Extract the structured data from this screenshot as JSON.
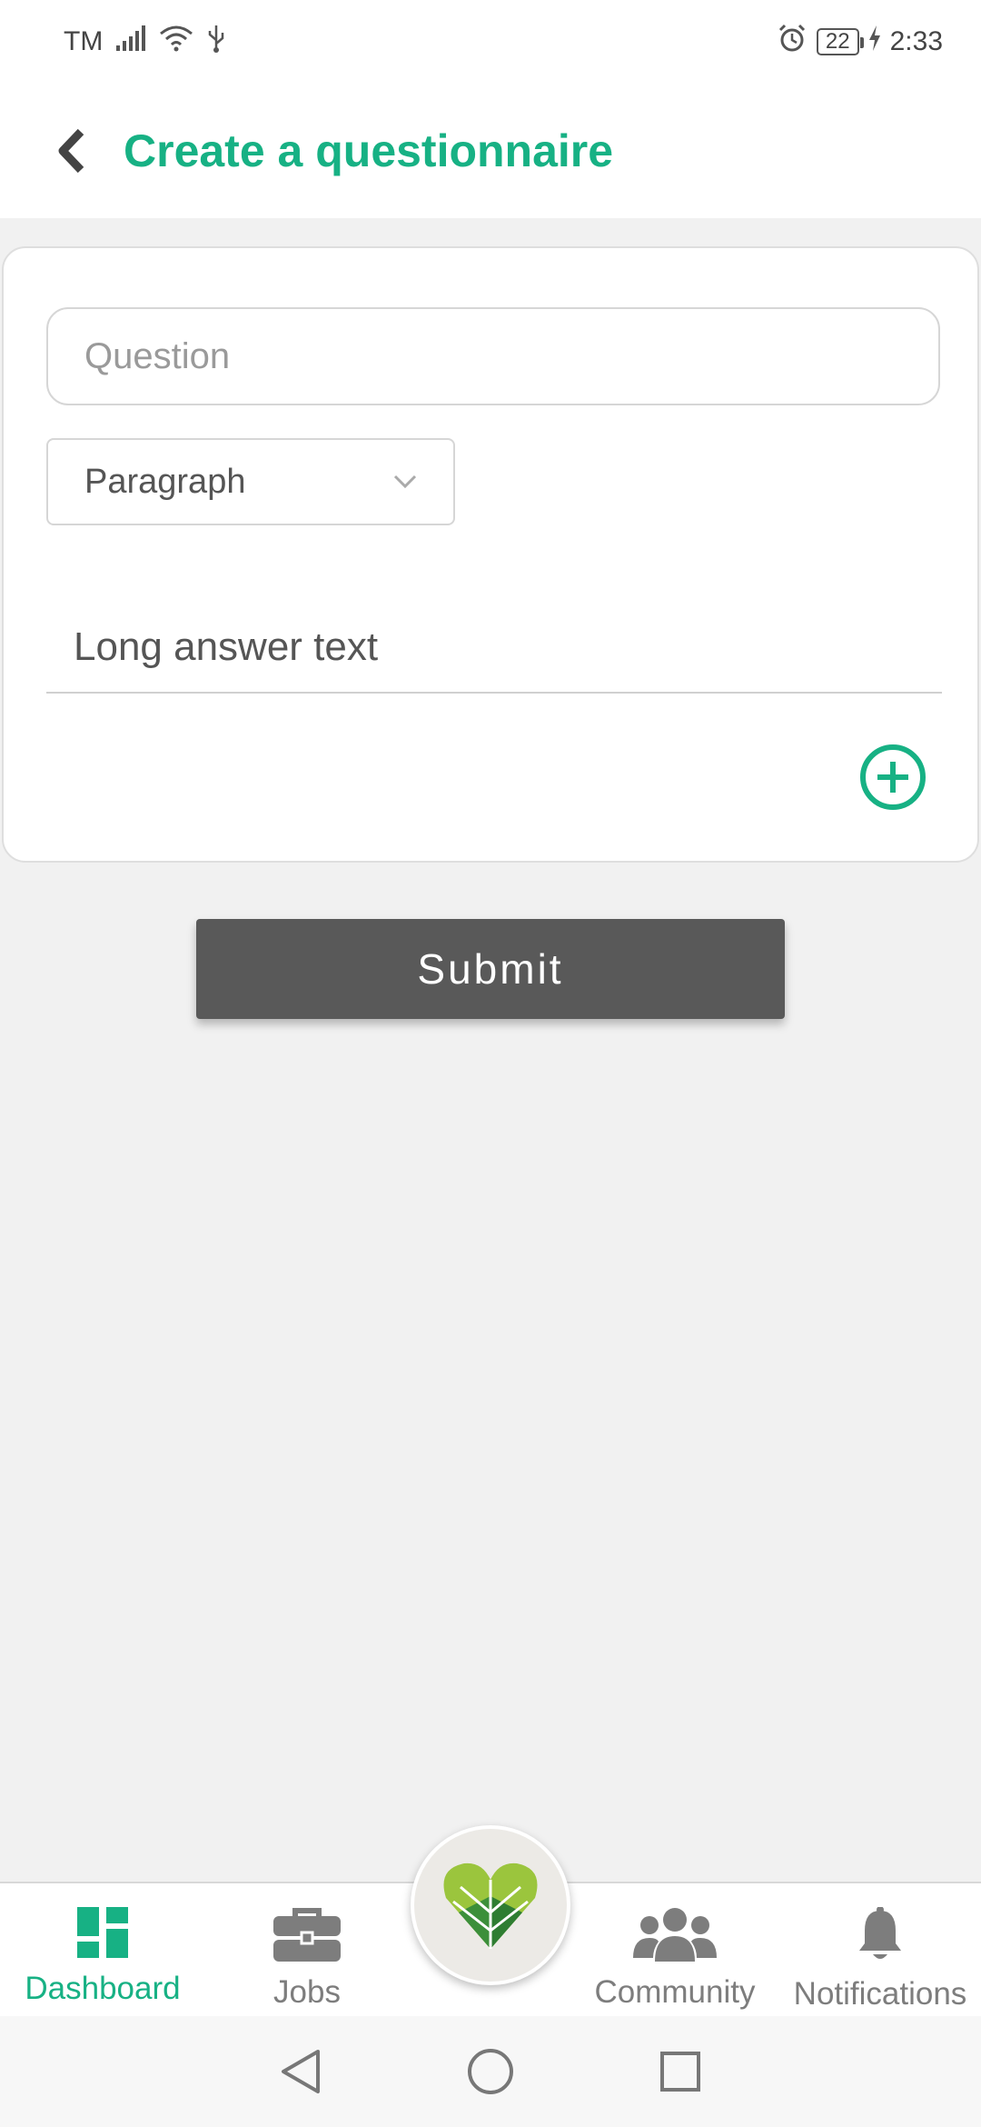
{
  "status_bar": {
    "carrier": "TM",
    "battery": "22",
    "time": "2:33",
    "icons": [
      "signal-icon",
      "wifi-icon",
      "usb-icon",
      "alarm-icon",
      "battery-icon",
      "charging-icon"
    ]
  },
  "header": {
    "title": "Create a questionnaire",
    "back_icon": "chevron-left-icon"
  },
  "form": {
    "question_placeholder": "Question",
    "question_value": "",
    "type_select": "Paragraph",
    "answer_preview": "Long answer text",
    "add_icon": "plus-circle-icon"
  },
  "submit_label": "Submit",
  "bottom_nav": {
    "items": [
      {
        "label": "Dashboard",
        "icon": "dashboard-icon",
        "active": true
      },
      {
        "label": "Jobs",
        "icon": "briefcase-icon",
        "active": false
      },
      {
        "label": "Community",
        "icon": "community-icon",
        "active": false
      },
      {
        "label": "Notifications",
        "icon": "bell-icon",
        "active": false
      }
    ],
    "center_icon": "heart-leaf-logo"
  },
  "system_nav": [
    "back-triangle-icon",
    "home-circle-icon",
    "recents-square-icon"
  ],
  "colors": {
    "accent": "#17b184",
    "submit_bg": "#595959",
    "background": "#f1f1f1",
    "nav_inactive": "#7d7d7d"
  }
}
